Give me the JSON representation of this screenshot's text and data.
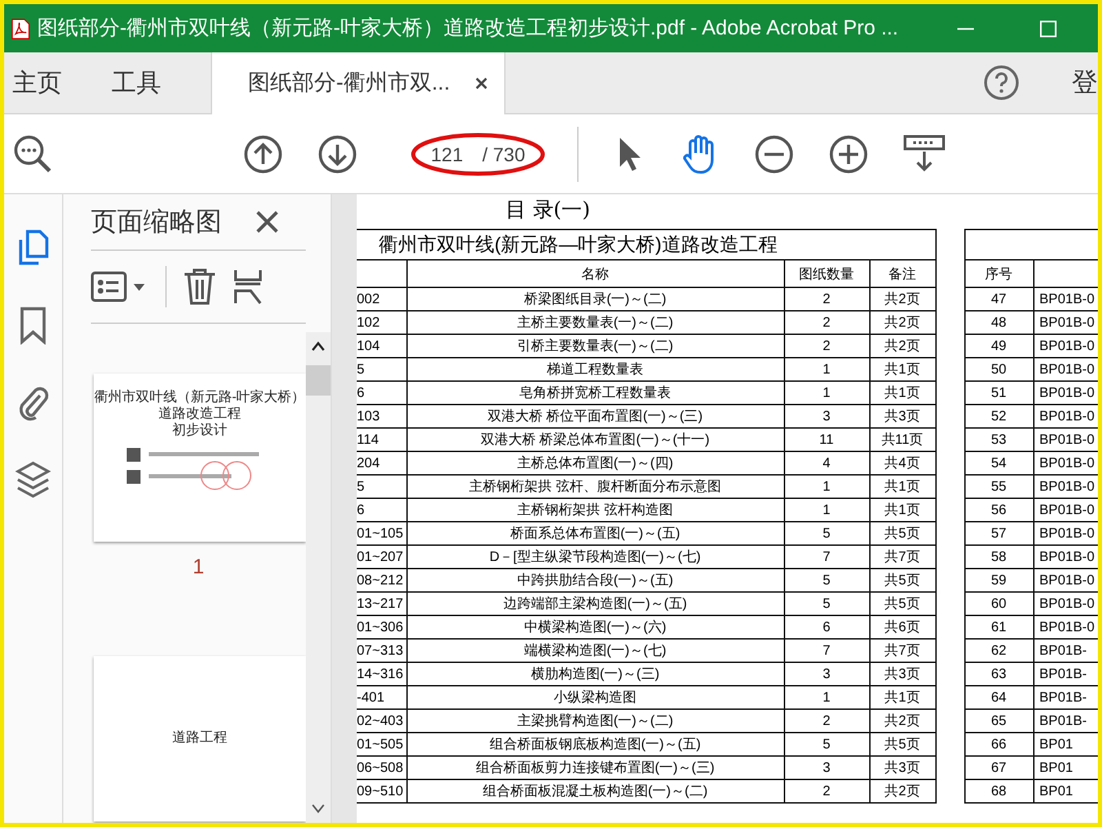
{
  "window": {
    "title": "图纸部分-衢州市双叶线（新元路-叶家大桥）道路改造工程初步设计.pdf - Adobe Acrobat Pro ..."
  },
  "tabs": [
    {
      "label": "主页",
      "kind": "nav",
      "selected": false
    },
    {
      "label": "工具",
      "kind": "nav",
      "selected": false
    },
    {
      "label": "图纸部分-衢州市双...",
      "kind": "document",
      "selected": true
    }
  ],
  "account_label": "登",
  "toolbar": {
    "page_number": "121",
    "page_total": "/ 730",
    "tools": [
      {
        "kind": "select",
        "selected": false
      },
      {
        "kind": "hand",
        "selected": true
      }
    ]
  },
  "sidebar": {
    "rail": [
      {
        "kind": "pages",
        "selected": true
      },
      {
        "kind": "bookmarks",
        "selected": false
      },
      {
        "kind": "attachments",
        "selected": false
      },
      {
        "kind": "layers",
        "selected": false
      }
    ],
    "panel_title": "页面缩略图",
    "thumbnails": [
      {
        "kind": "cover",
        "page_label": "1",
        "lines": [
          "衢州市双叶线（新元路-叶家大桥）",
          "道路改造工程",
          "初步设计"
        ]
      },
      {
        "kind": "section",
        "lines": [
          "道路工程"
        ]
      }
    ]
  },
  "document": {
    "heading": "目 录(一)",
    "left_table": {
      "title": "衢州市双叶线(新元路—叶家大桥)道路改造工程",
      "columns": [
        "名称",
        "图纸数量",
        "备注"
      ],
      "rows": [
        {
          "code": "002",
          "name": "桥梁图纸目录(一)～(二)",
          "count": "2",
          "note": "共2页"
        },
        {
          "code": "102",
          "name": "主桥主要数量表(一)～(二)",
          "count": "2",
          "note": "共2页"
        },
        {
          "code": "104",
          "name": "引桥主要数量表(一)～(二)",
          "count": "2",
          "note": "共2页"
        },
        {
          "code": "5",
          "name": "梯道工程数量表",
          "count": "1",
          "note": "共1页"
        },
        {
          "code": "6",
          "name": "皂角桥拼宽桥工程数量表",
          "count": "1",
          "note": "共1页"
        },
        {
          "code": "103",
          "name": "双港大桥 桥位平面布置图(一)～(三)",
          "count": "3",
          "note": "共3页"
        },
        {
          "code": "114",
          "name": "双港大桥 桥梁总体布置图(一)～(十一)",
          "count": "11",
          "note": "共11页"
        },
        {
          "code": "204",
          "name": "主桥总体布置图(一)～(四)",
          "count": "4",
          "note": "共4页"
        },
        {
          "code": "5",
          "name": "主桥钢桁架拱 弦杆、腹杆断面分布示意图",
          "count": "1",
          "note": "共1页"
        },
        {
          "code": "6",
          "name": "主桥钢桁架拱 弦杆构造图",
          "count": "1",
          "note": "共1页"
        },
        {
          "code": "01~105",
          "name": "桥面系总体布置图(一)～(五)",
          "count": "5",
          "note": "共5页"
        },
        {
          "code": "01~207",
          "name": "D－[型主纵梁节段构造图(一)～(七)",
          "count": "7",
          "note": "共7页"
        },
        {
          "code": "08~212",
          "name": "中跨拱肋结合段(一)～(五)",
          "count": "5",
          "note": "共5页"
        },
        {
          "code": "13~217",
          "name": "边跨端部主梁构造图(一)～(五)",
          "count": "5",
          "note": "共5页"
        },
        {
          "code": "01~306",
          "name": "中横梁构造图(一)～(六)",
          "count": "6",
          "note": "共6页"
        },
        {
          "code": "07~313",
          "name": "端横梁构造图(一)～(七)",
          "count": "7",
          "note": "共7页"
        },
        {
          "code": "14~316",
          "name": "横肋构造图(一)～(三)",
          "count": "3",
          "note": "共3页"
        },
        {
          "code": "-401",
          "name": "小纵梁构造图",
          "count": "1",
          "note": "共1页"
        },
        {
          "code": "02~403",
          "name": "主梁挑臂构造图(一)～(二)",
          "count": "2",
          "note": "共2页"
        },
        {
          "code": "01~505",
          "name": "组合桥面板钢底板构造图(一)～(五)",
          "count": "5",
          "note": "共5页"
        },
        {
          "code": "06~508",
          "name": "组合桥面板剪力连接键布置图(一)～(三)",
          "count": "3",
          "note": "共3页"
        },
        {
          "code": "09~510",
          "name": "组合桥面板混凝土板构造图(一)～(二)",
          "count": "2",
          "note": "共2页"
        }
      ]
    },
    "right_table": {
      "columns": [
        "序号"
      ],
      "rows": [
        {
          "no": "47",
          "code": "BP01B-0"
        },
        {
          "no": "48",
          "code": "BP01B-0"
        },
        {
          "no": "49",
          "code": "BP01B-0"
        },
        {
          "no": "50",
          "code": "BP01B-0"
        },
        {
          "no": "51",
          "code": "BP01B-0"
        },
        {
          "no": "52",
          "code": "BP01B-0"
        },
        {
          "no": "53",
          "code": "BP01B-0"
        },
        {
          "no": "54",
          "code": "BP01B-0"
        },
        {
          "no": "55",
          "code": "BP01B-0"
        },
        {
          "no": "56",
          "code": "BP01B-0"
        },
        {
          "no": "57",
          "code": "BP01B-0"
        },
        {
          "no": "58",
          "code": "BP01B-0"
        },
        {
          "no": "59",
          "code": "BP01B-0"
        },
        {
          "no": "60",
          "code": "BP01B-0"
        },
        {
          "no": "61",
          "code": "BP01B-0"
        },
        {
          "no": "62",
          "code": "BP01B-"
        },
        {
          "no": "63",
          "code": "BP01B-"
        },
        {
          "no": "64",
          "code": "BP01B-"
        },
        {
          "no": "65",
          "code": "BP01B-"
        },
        {
          "no": "66",
          "code": "BP01"
        },
        {
          "no": "67",
          "code": "BP01"
        },
        {
          "no": "68",
          "code": "BP01"
        }
      ]
    }
  }
}
